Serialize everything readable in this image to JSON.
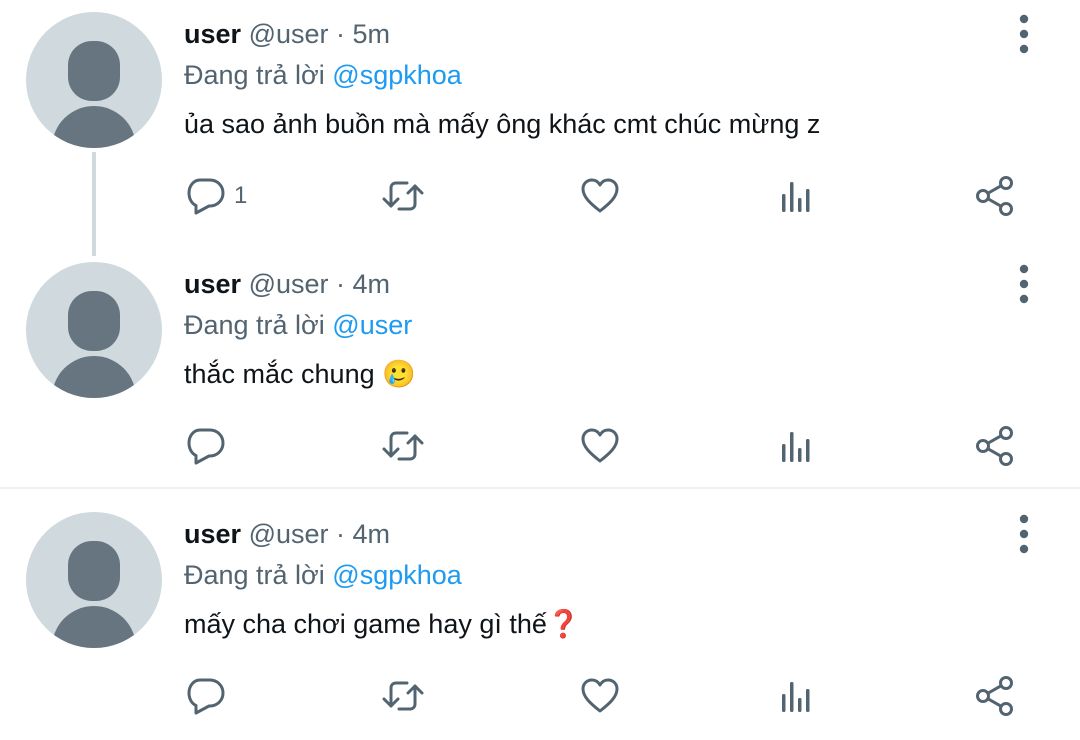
{
  "tweets": [
    {
      "name": "user",
      "handle": "@user",
      "separator": "·",
      "time": "5m",
      "reply_prefix": "Đang trả lời",
      "reply_to": "@sgpkhoa",
      "text": "ủa sao ảnh buồn mà mấy ông khác cmt chúc mừng z",
      "reply_count": "1"
    },
    {
      "name": "user",
      "handle": "@user",
      "separator": "·",
      "time": "4m",
      "reply_prefix": "Đang trả lời",
      "reply_to": "@user",
      "text": "thắc mắc chung 🥲",
      "reply_count": ""
    },
    {
      "name": "user",
      "handle": "@user",
      "separator": "·",
      "time": "4m",
      "reply_prefix": "Đang trả lời",
      "reply_to": "@sgpkhoa",
      "text": "mấy cha chơi game hay gì thế❓",
      "reply_count": ""
    }
  ],
  "icons": {
    "reply": "reply-icon",
    "retweet": "retweet-icon",
    "like": "heart-icon",
    "views": "views-icon",
    "share": "share-icon",
    "more": "more-vertical-icon"
  },
  "colors": {
    "mention": "#1d9bf0",
    "secondary_text": "#536471",
    "avatar_bg": "#cfd9de",
    "avatar_fg": "#66757f"
  }
}
